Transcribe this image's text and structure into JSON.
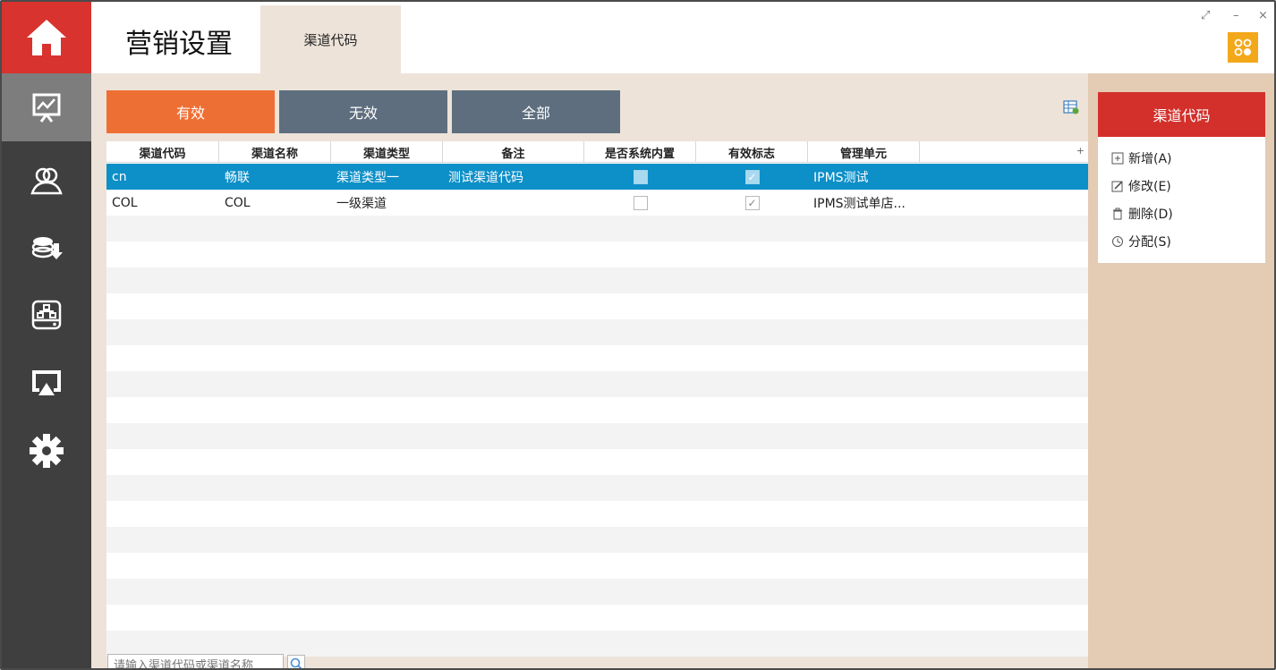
{
  "app_title": "营销设置",
  "tab_label": "渠道代码",
  "window_controls": {
    "restore": "⤢",
    "minimize": "–",
    "close": "×"
  },
  "filters": [
    "有效",
    "无效",
    "全部"
  ],
  "grid": {
    "columns": [
      "渠道代码",
      "渠道名称",
      "渠道类型",
      "备注",
      "是否系统内置",
      "有效标志",
      "管理单元"
    ],
    "rows": [
      {
        "code": "cn",
        "name": "畅联",
        "type": "渠道类型一",
        "remark": "测试渠道代码",
        "builtin": false,
        "valid": true,
        "unit": "IPMS测试"
      },
      {
        "code": "COL",
        "name": "COL",
        "type": "一级渠道",
        "remark": "",
        "builtin": false,
        "valid": true,
        "unit": "IPMS测试单店..."
      }
    ]
  },
  "search": {
    "placeholder": "请输入渠道代码或渠道名称"
  },
  "actions": {
    "title": "渠道代码",
    "items": [
      "新增(A)",
      "修改(E)",
      "删除(D)",
      "分配(S)"
    ]
  },
  "sidebar": {
    "items": [
      "home-icon",
      "presentation-chart-icon",
      "users-icon",
      "coins-download-icon",
      "network-drive-icon",
      "airplay-icon",
      "gear-icon"
    ]
  },
  "colors": {
    "accent_red": "#d3302b",
    "filter_active": "#ee6f34",
    "filter_inactive": "#5e6e7e",
    "row_selected": "#0d8fc8"
  }
}
